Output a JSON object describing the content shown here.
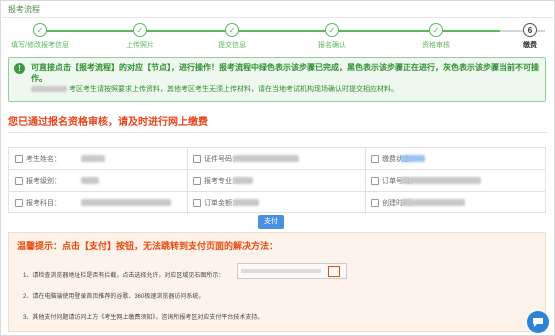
{
  "page": {
    "title": "报考流程"
  },
  "steps": [
    {
      "label": "填写/修改报考信息",
      "state": "done",
      "mark": "✓"
    },
    {
      "label": "上传照片",
      "state": "done",
      "mark": "✓"
    },
    {
      "label": "提交信息",
      "state": "done",
      "mark": "✓"
    },
    {
      "label": "报名确认",
      "state": "done",
      "mark": "✓"
    },
    {
      "label": "资格审核",
      "state": "done",
      "mark": "✓"
    },
    {
      "label": "缴费",
      "state": "current",
      "mark": "6"
    }
  ],
  "alert": {
    "icon": "!",
    "line1": "可直接点击【报考流程】的对应【节点】，进行操作！报考流程中绿色表示该步骤已完成，黑色表示该步骤正在进行，灰色表示该步骤当前不可操作。",
    "line2": "考区考生请按照要求上传资料，其他考区考生无须上传材料，请在当地考试机构现场确认时提交相应材料。"
  },
  "headline": "您已通过报名资格审核，请及时进行网上缴费",
  "info": {
    "rows": [
      [
        {
          "icon": "user-icon",
          "label": "考生姓名："
        },
        {
          "icon": "id-card-icon",
          "label": "证件号码："
        },
        {
          "icon": "payment-status-icon",
          "label": "缴费状态："
        }
      ],
      [
        {
          "icon": "registration-icon",
          "label": "报考级别："
        },
        {
          "icon": "major-icon",
          "label": "报考专业："
        },
        {
          "icon": "order-icon",
          "label": "订单号码："
        }
      ],
      [
        {
          "icon": "subject-icon",
          "label": "报考科目："
        },
        {
          "icon": "amount-icon",
          "label": "订单金额："
        },
        {
          "icon": "clock-icon",
          "label": "创建时间："
        }
      ]
    ]
  },
  "pay_button": "支付",
  "tips": {
    "heading": "温馨提示：点击【支付】按钮，无法跳转到支付页面的解决方法：",
    "items": [
      "1、请检查浏览器地址栏是否有拦截，点击选择允许，对应区域见右图所示：",
      "2、请在电脑端使用登录首页推荐的谷歌、360极速浏览器访问系统。",
      "3、其他支付问题请访问上方《考生网上缴费须知》，咨询所报考区对应支付平台技术支持。"
    ]
  },
  "colors": {
    "done": "#5cb85c",
    "current": "#333333",
    "alert_text": "#2f8f2f",
    "headline": "#e8431a",
    "pay": "#4a90e2"
  }
}
